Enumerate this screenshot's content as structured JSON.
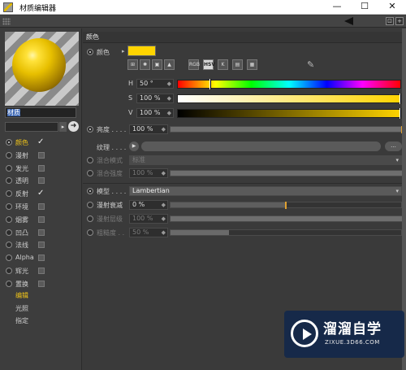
{
  "window": {
    "title": "材质编辑器",
    "controls": {
      "minimize": "—",
      "maximize": "☐",
      "close": "✕"
    }
  },
  "toolbar": {
    "lock_icon": "⊡",
    "add_icon": "+"
  },
  "sidebar": {
    "material_name_selected": "材质",
    "channels": [
      {
        "label": "颜色",
        "radio_on": true,
        "checkbox": "checked",
        "active": true
      },
      {
        "label": "漫射",
        "radio_on": false,
        "checkbox": "box",
        "active": false
      },
      {
        "label": "发光",
        "radio_on": false,
        "checkbox": "box",
        "active": false
      },
      {
        "label": "透明",
        "radio_on": false,
        "checkbox": "box",
        "active": false
      },
      {
        "label": "反射",
        "radio_on": false,
        "checkbox": "checked",
        "active": false
      },
      {
        "label": "环境",
        "radio_on": false,
        "checkbox": "box",
        "active": false
      },
      {
        "label": "烟雾",
        "radio_on": false,
        "checkbox": "box",
        "active": false
      },
      {
        "label": "凹凸",
        "radio_on": false,
        "checkbox": "box",
        "active": false
      },
      {
        "label": "法线",
        "radio_on": false,
        "checkbox": "box",
        "active": false
      },
      {
        "label": "Alpha",
        "radio_on": false,
        "checkbox": "box",
        "active": false
      },
      {
        "label": "辉光",
        "radio_on": false,
        "checkbox": "box",
        "active": false
      },
      {
        "label": "置换",
        "radio_on": false,
        "checkbox": "box",
        "active": false
      }
    ],
    "extra_items": [
      {
        "label": "编辑",
        "active": true
      },
      {
        "label": "光照",
        "active": false
      },
      {
        "label": "指定",
        "active": false
      }
    ],
    "checkmark": "✓"
  },
  "main": {
    "section_title": "颜色",
    "color_label": "颜色",
    "color_hex": "#ffd400",
    "picker_modes": [
      "⊞",
      "✺",
      "▣",
      "▲",
      "RGB",
      "HSV",
      "K",
      "▤",
      "▦"
    ],
    "picker_active": "HSV",
    "hsv": [
      {
        "label": "H",
        "value": "50 °",
        "knob_fraction": 0.14
      },
      {
        "label": "S",
        "value": "100 %",
        "knob_fraction": 1.0
      },
      {
        "label": "V",
        "value": "100 %",
        "knob_fraction": 1.0
      }
    ],
    "brightness_label": "亮度 . . . .",
    "brightness_value": "100 %",
    "brightness_fraction": 1.0,
    "texture_label": "纹理 . . . .",
    "texture_play": "▶",
    "texture_more": "...",
    "mix_mode_label": "混合模式",
    "mix_mode_value": "标准",
    "mix_strength_label": "混合强度",
    "mix_strength_value": "100 %",
    "mix_strength_fraction": 1.0,
    "model_label": "模型 . . . .",
    "model_value": "Lambertian",
    "diffuse_falloff_label": "漫射衰减",
    "diffuse_falloff_value": "0 %",
    "diffuse_falloff_fraction": 0.5,
    "diffuse_level_label": "漫射层级",
    "diffuse_level_value": "100 %",
    "diffuse_level_fraction": 1.0,
    "roughness_label": "粗糙度 . .",
    "roughness_value": "50 %",
    "roughness_fraction": 0.25,
    "spin": "◆",
    "chevron": "▾"
  },
  "watermark": {
    "text": "溜溜自学",
    "url": "ZIXUE.3D66.COM"
  }
}
